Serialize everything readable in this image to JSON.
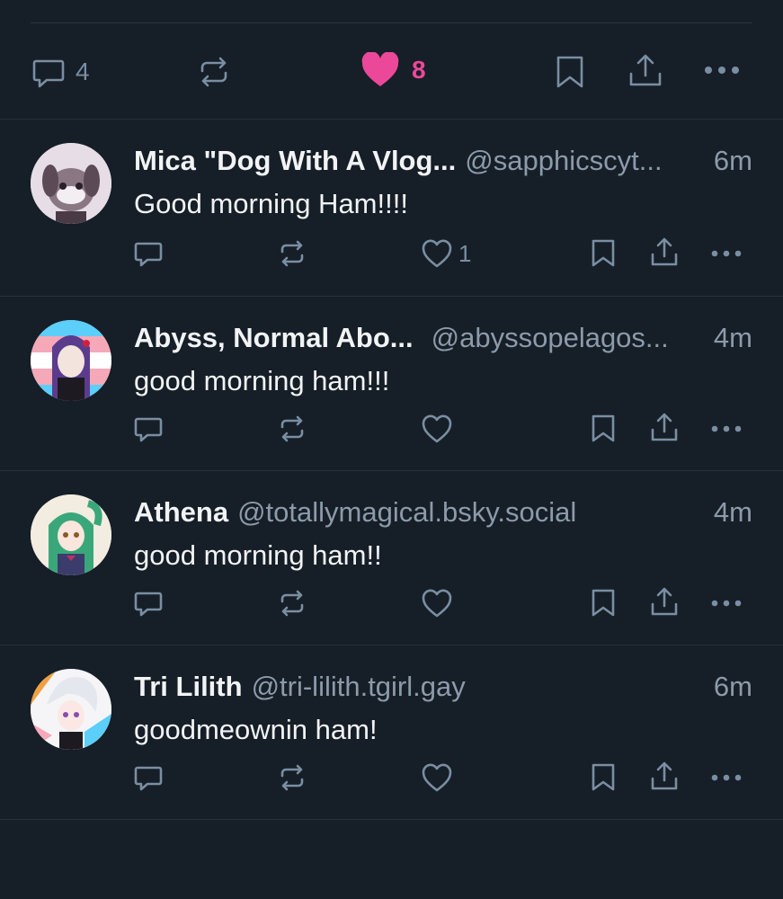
{
  "main_post_actions": {
    "reply_count": "4",
    "like_count": "8",
    "accent_like": "#ec4899",
    "icons": [
      "reply-icon",
      "repost-icon",
      "heart-filled-icon",
      "bookmark-icon",
      "share-icon",
      "more-icon"
    ]
  },
  "replies": [
    {
      "name": "Mica \"Dog With A Vlog...",
      "handle": "@sapphicscyt...",
      "time": "6m",
      "text": "Good morning Ham!!!!",
      "like_count": "1"
    },
    {
      "name": "Abyss, Normal Abo...",
      "handle": "@abyssopelagos...",
      "time": "4m",
      "text": "good morning ham!!!",
      "like_count": ""
    },
    {
      "name": "Athena",
      "handle": "@totallymagical.bsky.social",
      "time": "4m",
      "text": "good morning ham!!",
      "like_count": ""
    },
    {
      "name": "Tri Lilith",
      "handle": "@tri-lilith.tgirl.gay",
      "time": "6m",
      "text": "goodmeownin ham!",
      "like_count": ""
    }
  ],
  "colors": {
    "background": "#161e27",
    "icon": "#7a8ea3",
    "handle": "#8c9aaa",
    "like_accent": "#ec4899"
  }
}
